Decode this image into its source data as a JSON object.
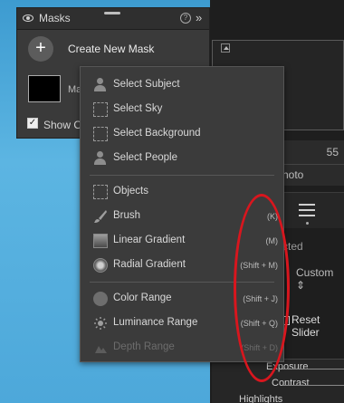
{
  "panel": {
    "title": "Masks",
    "create_label": "Create New Mask",
    "mask_name": "Ma",
    "show_label": "Show Ov",
    "help_glyph": "?",
    "collapse_glyph": "»",
    "add_glyph": "+"
  },
  "menu": {
    "items": [
      {
        "label": "Select Subject",
        "shortcut": "",
        "icon": "person-icon"
      },
      {
        "label": "Select Sky",
        "shortcut": "",
        "icon": "sky-icon"
      },
      {
        "label": "Select Background",
        "shortcut": "",
        "icon": "background-icon"
      },
      {
        "label": "Select People",
        "shortcut": "",
        "icon": "people-icon"
      },
      {
        "label": "Objects",
        "shortcut": "",
        "icon": "objects-icon"
      },
      {
        "label": "Brush",
        "shortcut": "(K)",
        "icon": "brush-icon"
      },
      {
        "label": "Linear Gradient",
        "shortcut": "(M)",
        "icon": "linear-gradient-icon"
      },
      {
        "label": "Radial Gradient",
        "shortcut": "(Shift + M)",
        "icon": "radial-gradient-icon"
      },
      {
        "label": "Color Range",
        "shortcut": "(Shift + J)",
        "icon": "color-range-icon"
      },
      {
        "label": "Luminance Range",
        "shortcut": "(Shift + Q)",
        "icon": "luminance-range-icon"
      },
      {
        "label": "Depth Range",
        "shortcut": "(Shift + D)",
        "icon": "depth-range-icon",
        "disabled": true
      }
    ]
  },
  "right_panel": {
    "value": "55",
    "photo_text": "hoto",
    "selected_text": "cted",
    "custom_text": "Custom  ⇕",
    "reset_text": "Reset Slider",
    "sliders": [
      "Exposure",
      "Contrast",
      "Highlights"
    ]
  },
  "colors": {
    "annotation": "#d8161e",
    "panel_bg": "#3a3a3a",
    "menu_bg": "#3b3b3b",
    "background_blue": "#4aa6d6"
  }
}
